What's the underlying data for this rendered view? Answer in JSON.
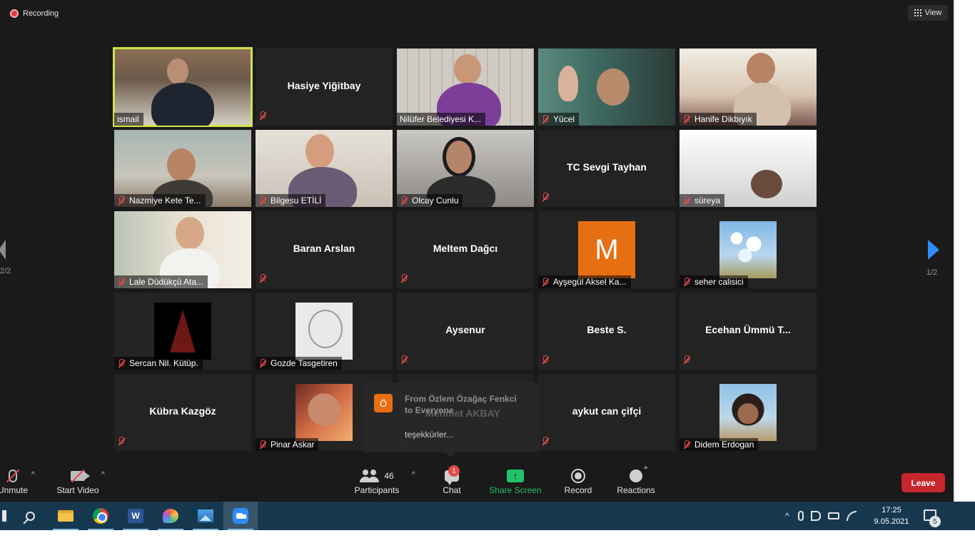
{
  "recording": {
    "label": "Recording"
  },
  "view_button": {
    "label": "View"
  },
  "participants_tiles": [
    {
      "name": "ismail",
      "display": "video",
      "muted": false,
      "active": true
    },
    {
      "name": "Hasiye Yiğitbay",
      "display": "name",
      "muted": true
    },
    {
      "name": "Nilüfer Belediyesi K...",
      "display": "video",
      "muted": false
    },
    {
      "name": "Yücel",
      "display": "video",
      "muted": true
    },
    {
      "name": "Hanife Dikbıyık",
      "display": "video",
      "muted": true
    },
    {
      "name": "Nazmiye Kete Te...",
      "display": "video",
      "muted": true
    },
    {
      "name": "Bilgesu ETİLİ",
      "display": "video",
      "muted": true
    },
    {
      "name": "Olcay Cunlu",
      "display": "video",
      "muted": true
    },
    {
      "name": "TC Sevgi Tayhan",
      "display": "name",
      "muted": true
    },
    {
      "name": "süreya",
      "display": "video",
      "muted": true
    },
    {
      "name": "Lale Düdükçü Ata...",
      "display": "video",
      "muted": true
    },
    {
      "name": "Baran Arslan",
      "display": "name",
      "muted": true
    },
    {
      "name": "Meltem Dağcı",
      "display": "name",
      "muted": true
    },
    {
      "name": "Ayşegül Aksel Ka...",
      "display": "avatar",
      "avatar_letter": "M",
      "muted": true
    },
    {
      "name": "seher calisici",
      "display": "avatar",
      "muted": true
    },
    {
      "name": "Sercan Nil. Kütüp.",
      "display": "avatar",
      "muted": true
    },
    {
      "name": "Gozde Tasgetiren",
      "display": "avatar",
      "muted": true
    },
    {
      "name": "Aysenur",
      "display": "name",
      "muted": true
    },
    {
      "name": "Beste S.",
      "display": "name",
      "muted": true
    },
    {
      "name": "Ecehan Ümmü T...",
      "display": "name",
      "muted": true
    },
    {
      "name": "Kübra Kazgöz",
      "display": "name",
      "muted": true
    },
    {
      "name": "Pinar Askar",
      "display": "avatar",
      "muted": true
    },
    {
      "name": "Mehmet AKBAY",
      "display": "name",
      "muted": true
    },
    {
      "name": "aykut can çifçi",
      "display": "name",
      "muted": true
    },
    {
      "name": "Didem Erdogan",
      "display": "avatar",
      "muted": true
    }
  ],
  "pagination": {
    "left": "2/2",
    "right": "1/2"
  },
  "chat_toast": {
    "avatar_letter": "Ö",
    "from_line1": "From Özlem Özağaç Fenkci",
    "from_line2": "to Everyone",
    "message": "teşekkürler..."
  },
  "toolbar": {
    "unmute": "Unmute",
    "start_video": "Start Video",
    "participants_count": "46",
    "participants": "Participants",
    "chat": "Chat",
    "chat_badge": "1",
    "share_screen": "Share Screen",
    "record": "Record",
    "reactions": "Reactions",
    "leave": "Leave"
  },
  "taskbar": {
    "time": "17:25",
    "date": "9.05.2021",
    "notifications": "5",
    "word_letter": "W"
  },
  "colors": {
    "active_speaker": "#cfe34a",
    "share": "#24c26a",
    "leave": "#c8262d",
    "muted": "#e24a4a",
    "nav": "#2d8cff",
    "taskbar": "#16384f"
  }
}
